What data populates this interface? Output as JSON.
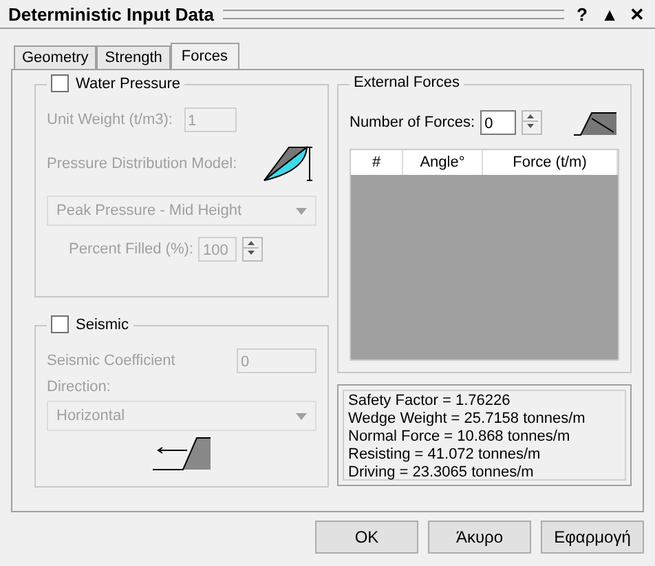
{
  "window": {
    "title": "Deterministic Input Data",
    "controls": [
      "?",
      "▲",
      "✕"
    ]
  },
  "tabs": [
    {
      "label": "Geometry",
      "selected": false
    },
    {
      "label": "Strength",
      "selected": false
    },
    {
      "label": "Forces",
      "selected": true
    }
  ],
  "water_pressure": {
    "label": "Water Pressure",
    "checked": false,
    "unit_weight_label": "Unit Weight (t/m3):",
    "unit_weight": "1",
    "model_label": "Pressure Distribution Model:",
    "model": "Peak Pressure - Mid Height",
    "percent_label": "Percent Filled (%):",
    "percent": "100",
    "disabled": true
  },
  "seismic": {
    "label": "Seismic",
    "checked": false,
    "coefficient_label": "Seismic Coefficient",
    "coefficient": "0",
    "direction_label": "Direction:",
    "direction": "Horizontal",
    "disabled": true
  },
  "external_forces": {
    "title": "External Forces",
    "count_label": "Number of Forces:",
    "count": "0",
    "columns": [
      "#",
      "Angle°",
      "Force (t/m)"
    ]
  },
  "results": [
    "Safety Factor = 1.76226",
    "Wedge Weight = 25.7158 tonnes/m",
    "Normal Force = 10.868 tonnes/m",
    "Resisting = 41.072 tonnes/m",
    "Driving = 23.3065 tonnes/m"
  ],
  "buttons": [
    "OK",
    "Άκυρο",
    "Εφαρμογή"
  ]
}
